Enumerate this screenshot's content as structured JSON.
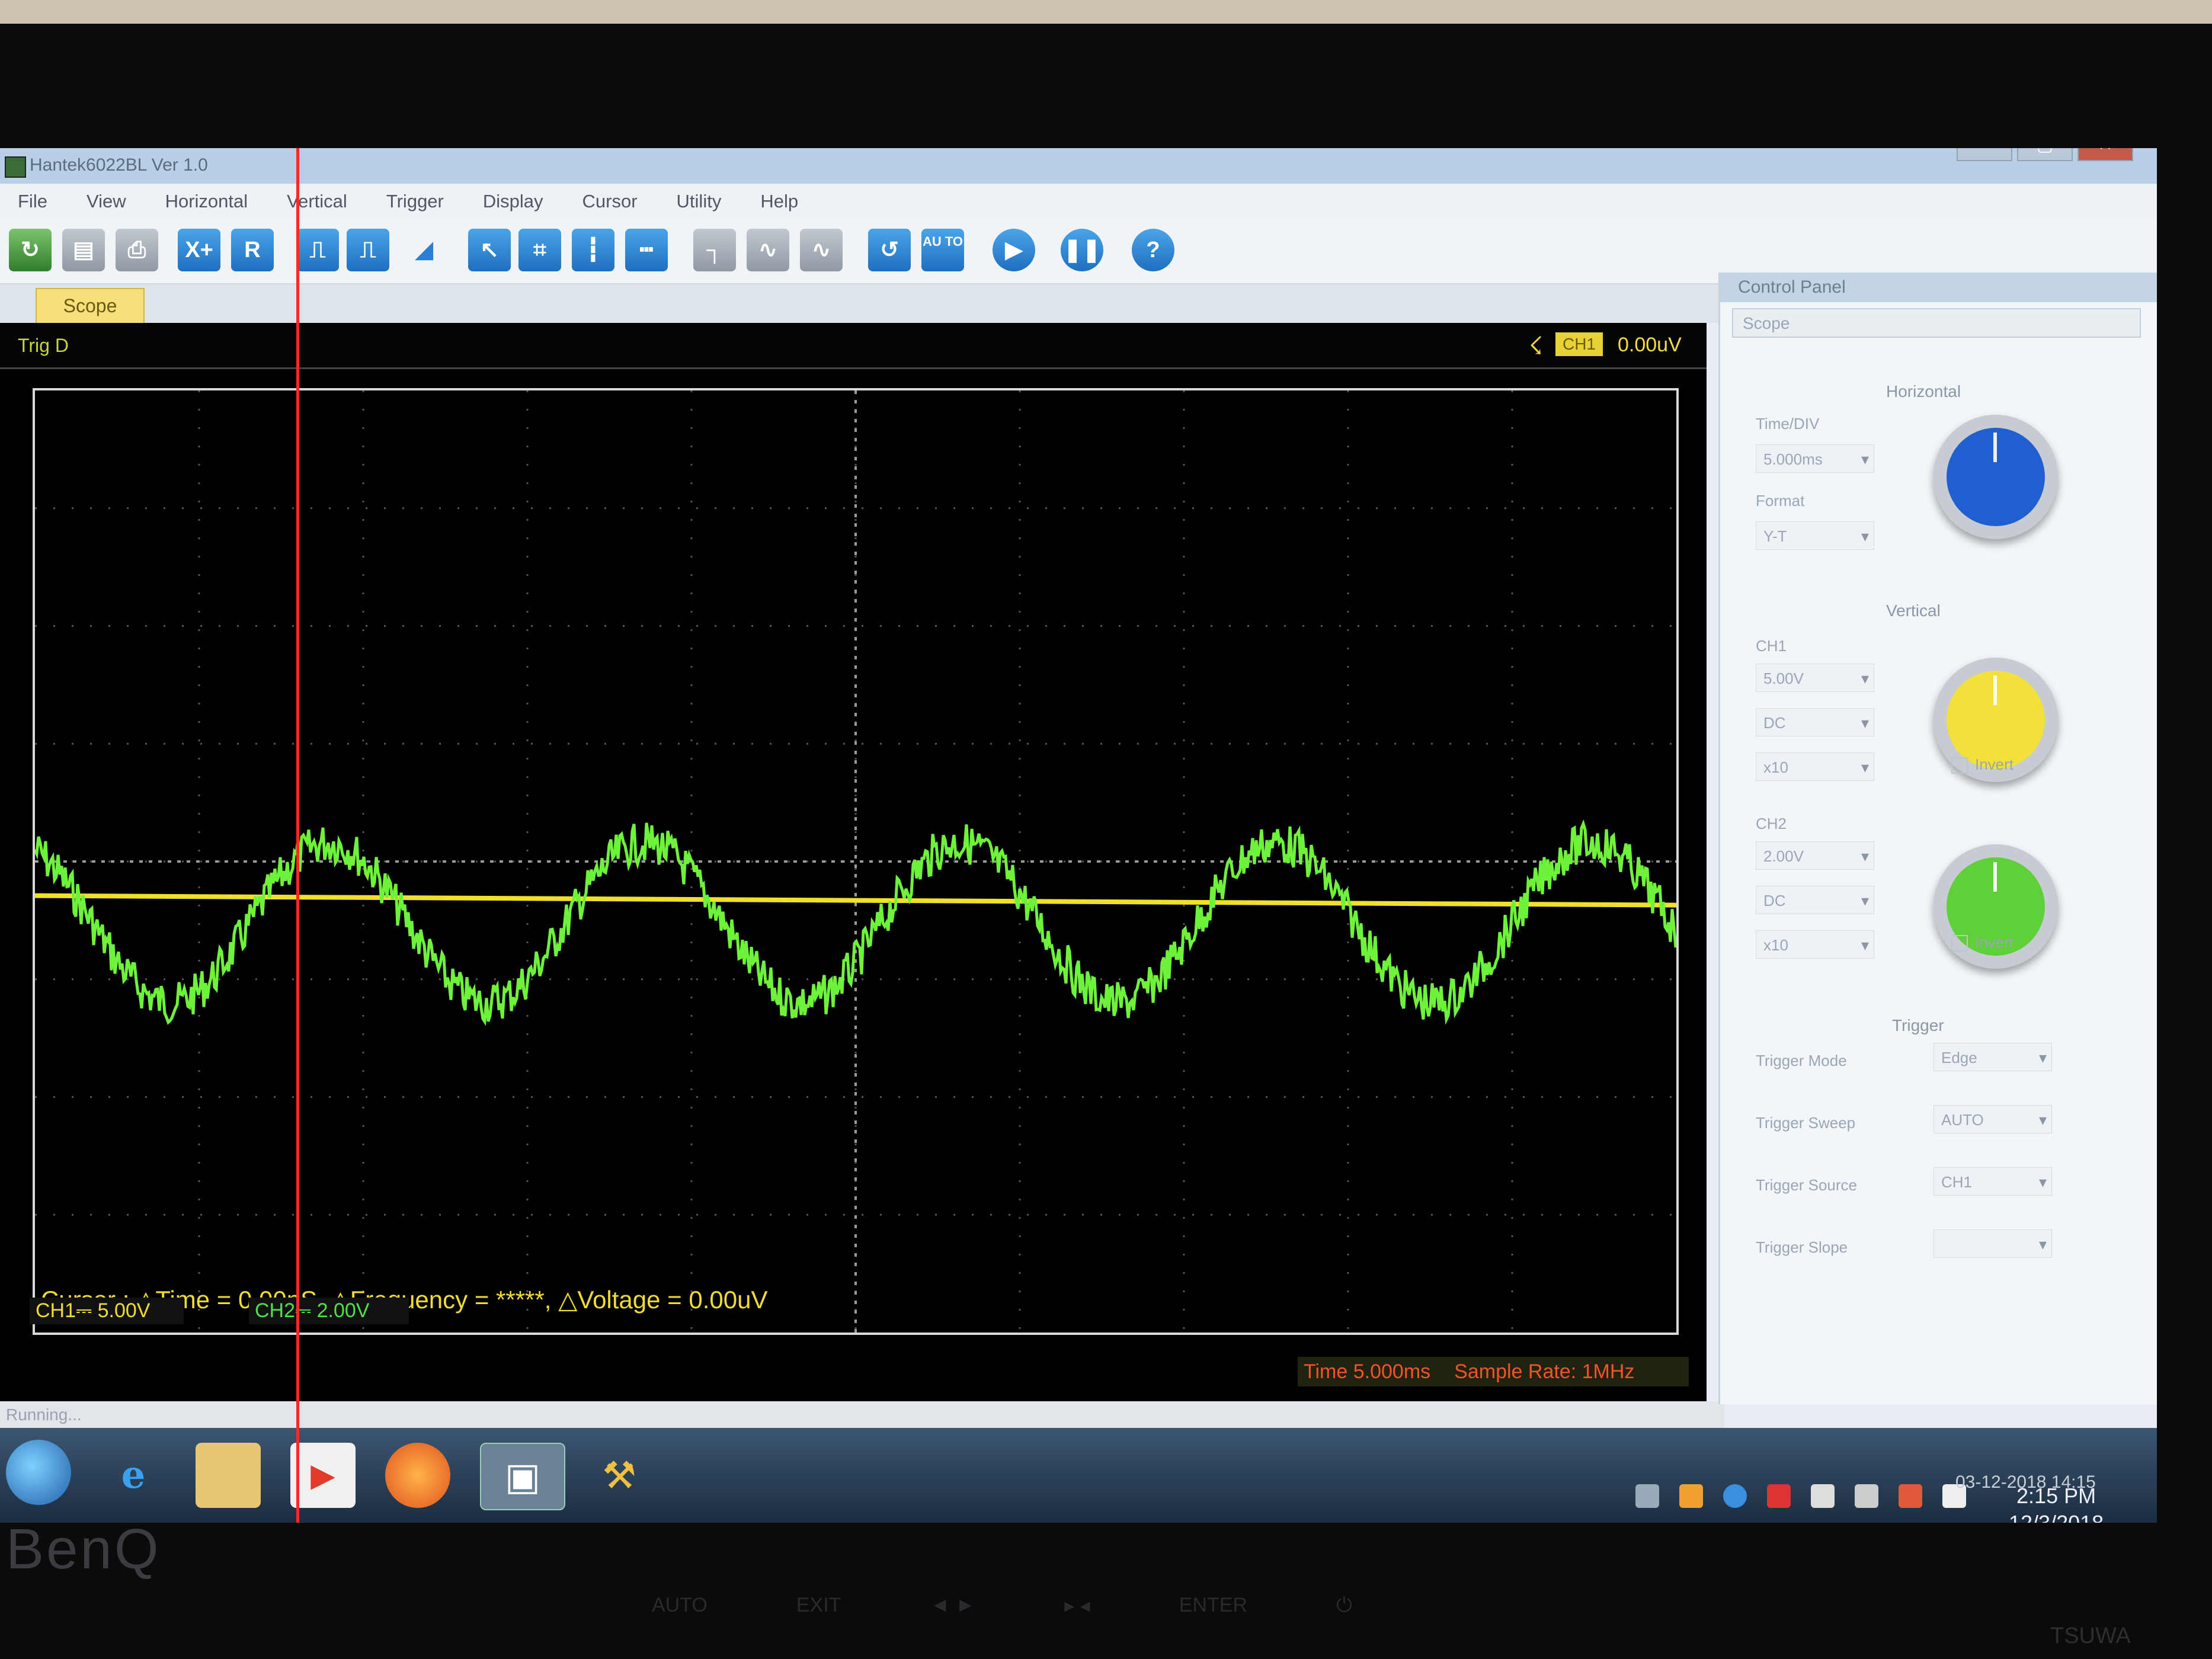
{
  "window": {
    "title": "Hantek6022BL Ver 1.0",
    "controls": [
      "–",
      "▢",
      "✕"
    ]
  },
  "menu": [
    "File",
    "View",
    "Horizontal",
    "Vertical",
    "Trigger",
    "Display",
    "Cursor",
    "Utility",
    "Help"
  ],
  "toolbar": {
    "buttons": [
      {
        "name": "open-icon"
      },
      {
        "name": "save-icon"
      },
      {
        "name": "print-icon"
      },
      {
        "name": "xy-icon",
        "label": "X+"
      },
      {
        "name": "reference-icon",
        "label": "R"
      },
      {
        "name": "pulse-ch1-icon"
      },
      {
        "name": "pulse-ch2-icon"
      },
      {
        "name": "ramp-icon"
      },
      {
        "name": "cursor-select-icon"
      },
      {
        "name": "grid-icon"
      },
      {
        "name": "vertical-cursor-icon"
      },
      {
        "name": "horizontal-cursor-icon"
      },
      {
        "name": "step-wave-icon"
      },
      {
        "name": "noise-wave-icon"
      },
      {
        "name": "sine-wave-icon"
      },
      {
        "name": "refresh-icon"
      },
      {
        "name": "auto-icon",
        "label": "AU TO"
      },
      {
        "name": "play-icon"
      },
      {
        "name": "pause-icon"
      },
      {
        "name": "help-icon",
        "label": "?"
      }
    ]
  },
  "tabs": {
    "scope": "Scope"
  },
  "scope": {
    "trigger_status": "Trig D",
    "trigger_channel": "CH1",
    "trigger_level": "0.00uV",
    "cursor_readout": "Cursor : △Time = 0.00nS, △Frequency = *****, △Voltage = 0.00uV",
    "ch1_scale": "CH1⎓ 5.00V",
    "ch2_scale": "CH2⎓ 2.00V",
    "time_div": "Time 5.000ms",
    "sample_rate": "Sample Rate: 1MHz"
  },
  "traces": {
    "ch1_color": "#f0e02a",
    "ch2_color": "#6ff23a",
    "cursor_color": "#ff2a1e"
  },
  "status": "Running...",
  "control_panel": {
    "title": "Control Panel",
    "selector": "Scope",
    "horizontal": {
      "section": "Horizontal",
      "time_div_label": "Time/DIV",
      "time_div_value": "5.000ms",
      "format_label": "Format",
      "format_value": "Y-T"
    },
    "vertical": {
      "section": "Vertical",
      "ch1": {
        "label": "CH1",
        "volt_div": "5.00V",
        "coupling": "DC",
        "probe": "x10",
        "invert": "Invert"
      },
      "ch2": {
        "label": "CH2",
        "volt_div": "2.00V",
        "coupling": "DC",
        "probe": "x10",
        "invert": "Invert"
      }
    },
    "trigger": {
      "section": "Trigger",
      "mode_label": "Trigger Mode",
      "mode_value": "Edge",
      "sweep_label": "Trigger Sweep",
      "sweep_value": "AUTO",
      "source_label": "Trigger Source",
      "source_value": "CH1",
      "slope_label": "Trigger Slope"
    },
    "knob_colors": {
      "horizontal": "#1f5fd0",
      "ch1": "#f3e03a",
      "ch2": "#5fd03a"
    }
  },
  "taskbar": {
    "clock_time": "2:15 PM",
    "clock_date": "12/3/2018"
  },
  "watermark": "03-12-2018 14:15",
  "monitor": {
    "brand": "BenQ",
    "buttons": [
      "AUTO",
      "EXIT",
      "◄  ►",
      "▸  ◂",
      "ENTER",
      "⏻"
    ],
    "stand_brand": "TSUWA"
  }
}
